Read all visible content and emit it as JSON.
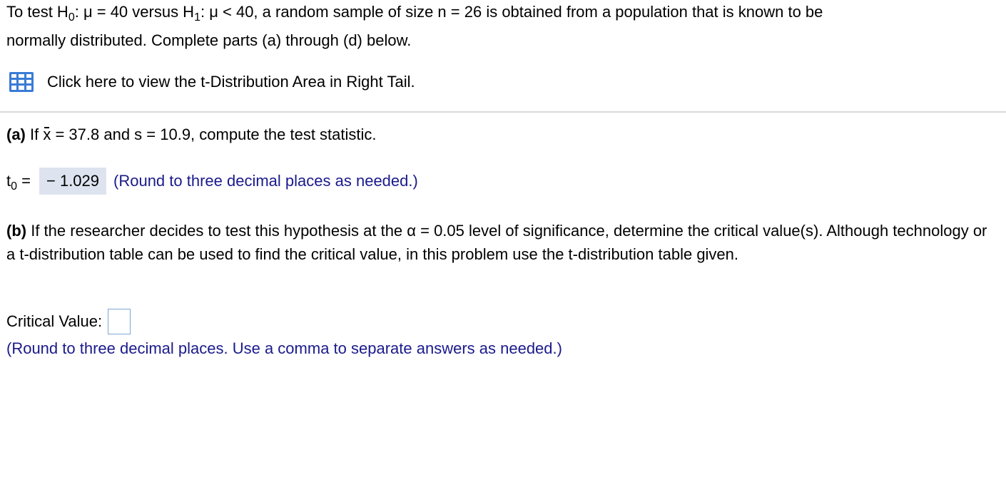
{
  "problem": {
    "p1": "To test H",
    "sub0": "0",
    "p2": ": μ = 40 versus H",
    "sub1": "1",
    "p3": ": μ < 40, a random sample of size n = 26 is obtained from a population that is known to be",
    "line2": "normally distributed. Complete parts (a) through (d) below."
  },
  "tool": {
    "icon": "table-grid-icon",
    "label": "Click here to view the t-Distribution Area in Right Tail."
  },
  "part_a": {
    "label": "(a)",
    "t1": " If ",
    "xbar": "x",
    "t2": " = 37.8 and s = 10.9, compute the test statistic.",
    "t_symbol": "t",
    "t_sub": "0",
    "equals": " =",
    "answer": "− 1.029",
    "hint": "(Round to three decimal places as needed.)"
  },
  "part_b": {
    "label": "(b)",
    "text": " If the researcher decides to test this hypothesis at the α = 0.05 level of significance, determine the critical value(s). Although technology or a t-distribution table can be used to find the critical value, in this problem use the t-distribution table given.",
    "crit_label": "Critical Value:",
    "crit_value": "",
    "hint": "(Round to three decimal places. Use a comma to separate answers as needed.)"
  },
  "colors": {
    "hint_blue": "#1a1a8c",
    "answer_bg": "#dde3ef",
    "icon_blue": "#3a7bd5"
  }
}
